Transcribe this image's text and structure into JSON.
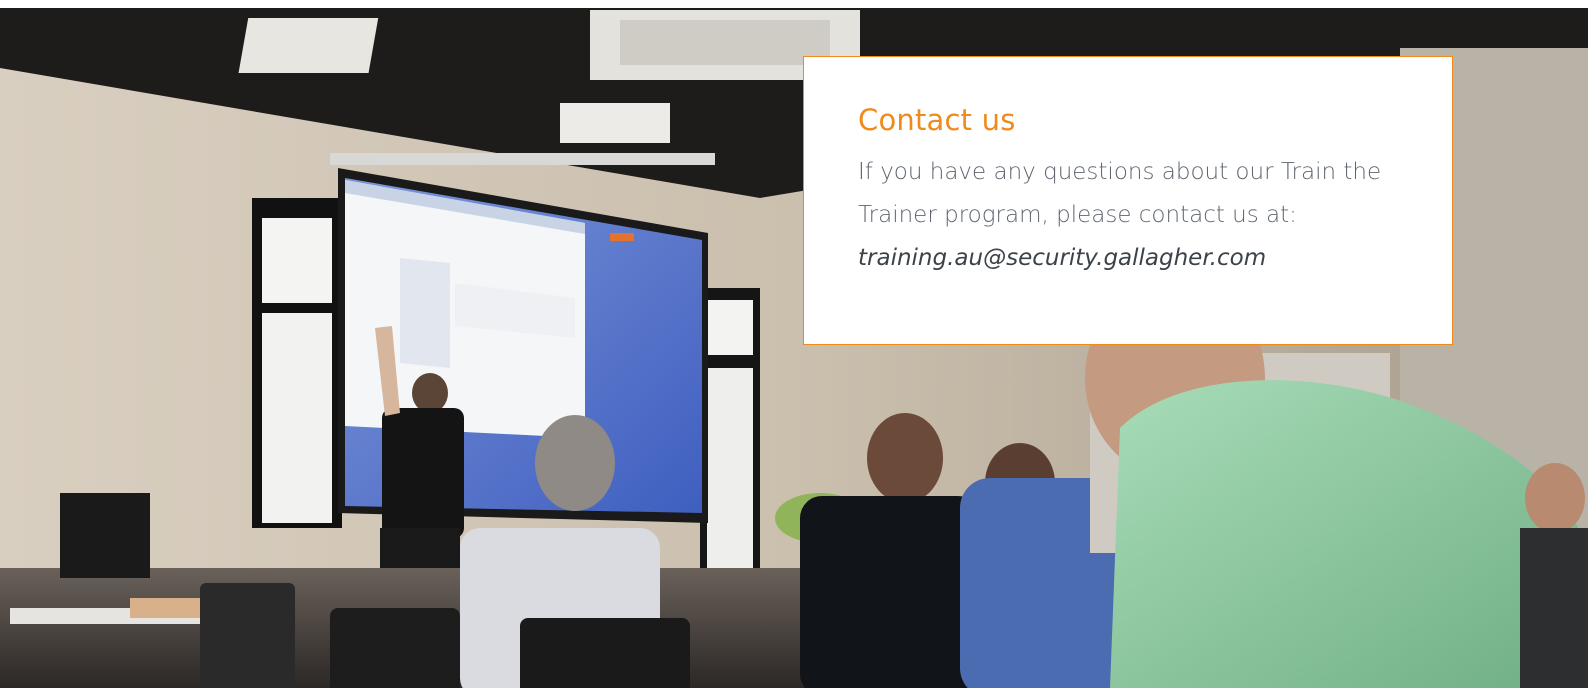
{
  "contact": {
    "title": "Contact us",
    "body": "If you have any questions about our Train the Trainer program, please contact us at:",
    "email": "training.au@security.gallagher.com"
  },
  "colors": {
    "accent": "#f08a1c",
    "text": "#5f6670",
    "email_text": "#3c4249",
    "card_background": "#ffffff"
  },
  "hero": {
    "description_icon": "photo-training-room"
  }
}
